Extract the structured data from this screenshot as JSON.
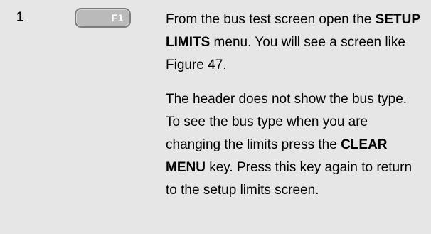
{
  "step": {
    "number": "1",
    "key_label": "F1"
  },
  "paragraph1": {
    "part1": "From  the bus test screen open the ",
    "bold1": "SETUP LIMITS",
    "part2": " menu. You will see a screen like Figure 47."
  },
  "paragraph2": {
    "part1": "The header does not show the bus type. To see the bus type when you are changing the limits press the ",
    "bold1": "CLEAR MENU",
    "part2": " key. Press this key again to return to the setup limits screen."
  }
}
